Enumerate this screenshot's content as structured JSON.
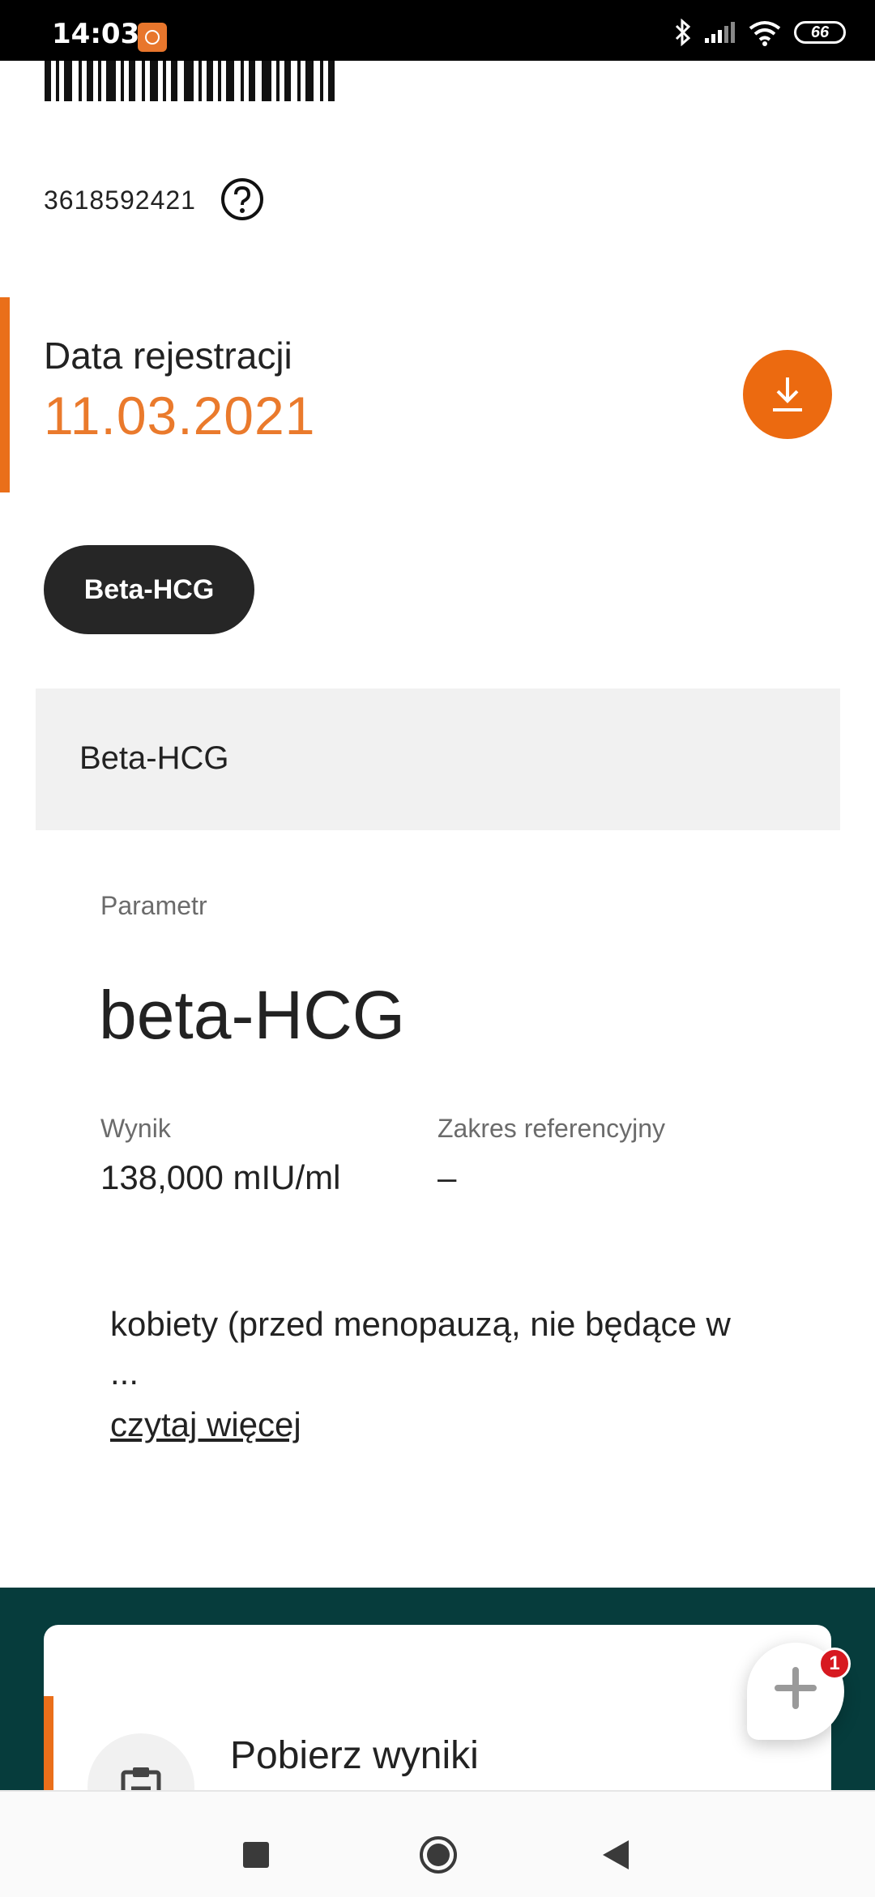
{
  "status_bar": {
    "time": "14:03",
    "battery": "66",
    "icons": [
      "app-notification-icon",
      "bluetooth-icon",
      "signal-icon",
      "wifi-icon",
      "battery-icon"
    ]
  },
  "barcode": {
    "number": "3618592421"
  },
  "registration": {
    "label": "Data rejestracji",
    "date": "11.03.2021"
  },
  "test_chip": {
    "label": "Beta-HCG"
  },
  "section": {
    "title": "Beta-HCG"
  },
  "parameter": {
    "label": "Parametr",
    "name": "beta-HCG",
    "result_label": "Wynik",
    "result_value": "138,000 mIU/ml",
    "reference_label": "Zakres referencyjny",
    "reference_value": "–"
  },
  "description": {
    "text": "kobiety (przed menopauzą, nie będące w",
    "ellipsis": "...",
    "read_more": "czytaj więcej"
  },
  "bottom_card": {
    "title": "Pobierz wyniki"
  },
  "fab": {
    "badge_count": "1"
  },
  "colors": {
    "accent": "#ea6f1a",
    "dark_teal": "#063c3c",
    "chip_dark": "#262626",
    "badge_red": "#d71920"
  }
}
